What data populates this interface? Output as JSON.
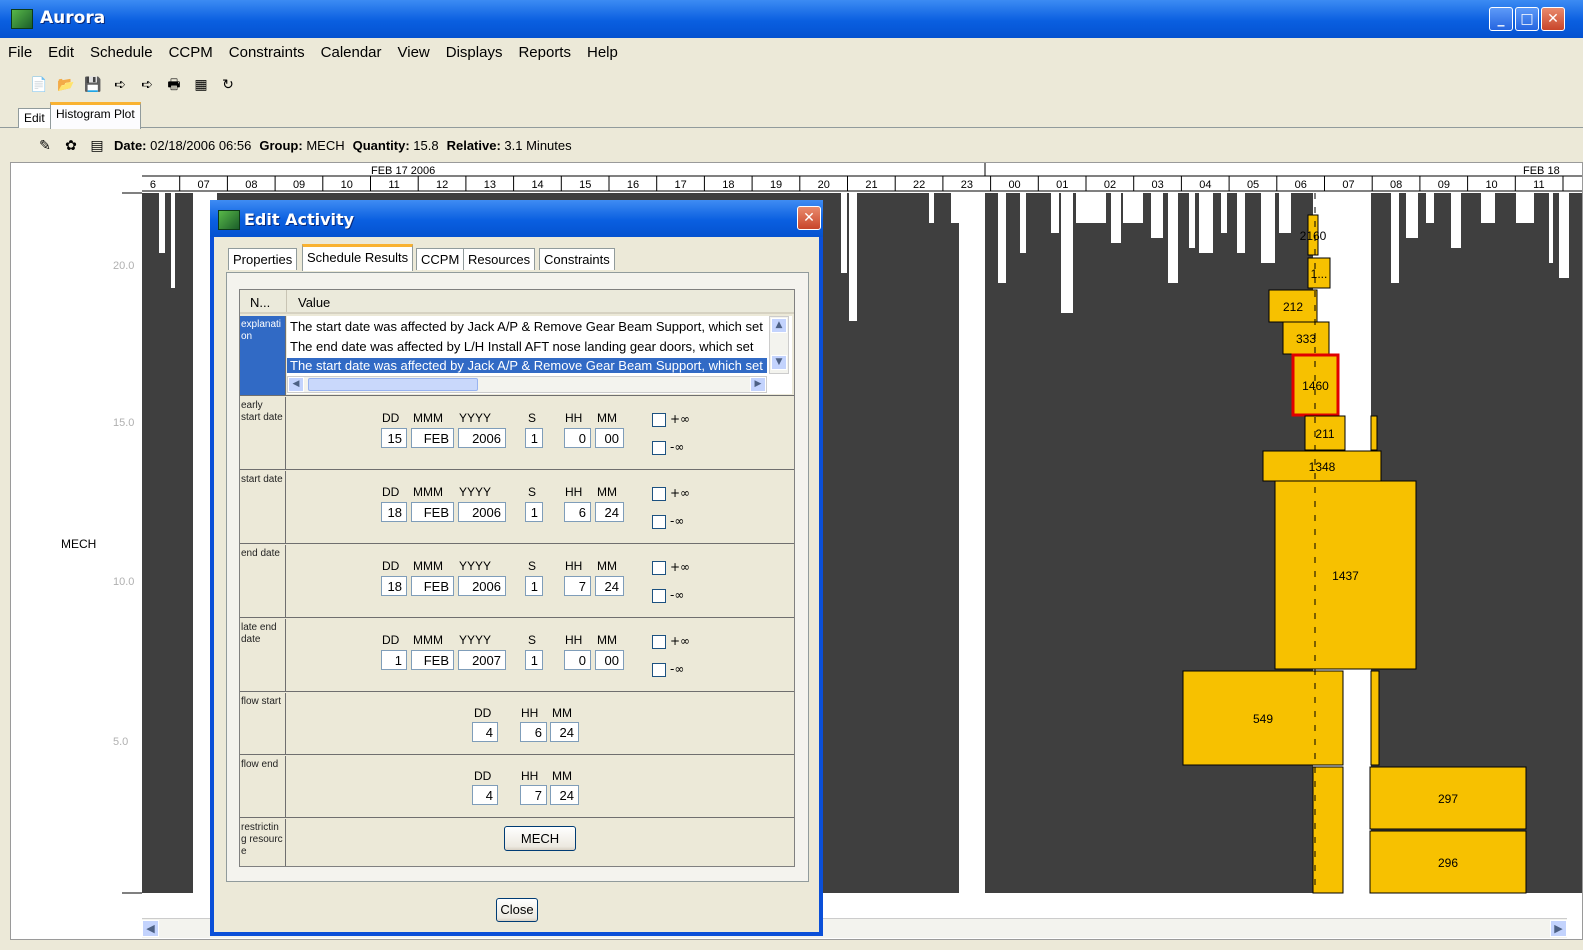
{
  "window": {
    "title": "Aurora"
  },
  "menu": [
    "File",
    "Edit",
    "Schedule",
    "CCPM",
    "Constraints",
    "Calendar",
    "View",
    "Displays",
    "Reports",
    "Help"
  ],
  "tabs": [
    "Edit",
    "Histogram Plot"
  ],
  "infobar": {
    "date_label": "Date:",
    "date_value": "02/18/2006 06:56",
    "group_label": "Group:",
    "group_value": "MECH",
    "quantity_label": "Quantity:",
    "quantity_value": "15.8",
    "relative_label": "Relative:",
    "relative_value": "3.1 Minutes"
  },
  "chart": {
    "date_label_1": "FEB 17 2006",
    "date_label_2": "FEB 18",
    "hours": [
      "6",
      "07",
      "08",
      "09",
      "10",
      "11",
      "12",
      "13",
      "14",
      "15",
      "16",
      "17",
      "18",
      "19",
      "20",
      "21",
      "22",
      "23",
      "00",
      "01",
      "02",
      "03",
      "04",
      "05",
      "06",
      "07",
      "08",
      "09",
      "10",
      "11"
    ],
    "y_ticks": [
      "20.0",
      "15.0",
      "10.0",
      "5.0"
    ],
    "group_name": "MECH",
    "bar_labels": [
      "2160",
      "1...",
      "212",
      "333",
      "1460",
      "211",
      "1348",
      "1437",
      "549",
      "297",
      "296"
    ],
    "colors": {
      "background_bars": "#3f3f3f",
      "activity": "#f7c100",
      "selected_border": "#e00000"
    }
  },
  "dialog": {
    "title": "Edit Activity",
    "tabs": [
      "Properties",
      "Schedule Results",
      "CCPM",
      "Resources",
      "Constraints"
    ],
    "table_headers": [
      "N...",
      "Value"
    ],
    "explanation": {
      "name": "explanation",
      "lines": [
        "The start date was affected by Jack A/P & Remove Gear Beam Support, which set",
        "The end date was affected by L/H Install AFT nose landing gear doors, which set",
        "The start date was affected by Jack A/P & Remove Gear Beam Support, which set"
      ]
    },
    "date_headers": {
      "dd": "DD",
      "mmm": "MMM",
      "yyyy": "YYYY",
      "s": "S",
      "hh": "HH",
      "mm": "MM"
    },
    "plus_inf": "+∞",
    "minus_inf": "-∞",
    "rows": [
      {
        "name": "early start date",
        "dd": "15",
        "mmm": "FEB",
        "yyyy": "2006",
        "s": "1",
        "hh": "0",
        "mm": "00"
      },
      {
        "name": "start date",
        "dd": "18",
        "mmm": "FEB",
        "yyyy": "2006",
        "s": "1",
        "hh": "6",
        "mm": "24"
      },
      {
        "name": "end date",
        "dd": "18",
        "mmm": "FEB",
        "yyyy": "2006",
        "s": "1",
        "hh": "7",
        "mm": "24"
      },
      {
        "name": "late end date",
        "dd": "1",
        "mmm": "FEB",
        "yyyy": "2007",
        "s": "1",
        "hh": "0",
        "mm": "00"
      }
    ],
    "flow_rows": [
      {
        "name": "flow start",
        "dd": "4",
        "hh": "6",
        "mm": "24"
      },
      {
        "name": "flow end",
        "dd": "4",
        "hh": "7",
        "mm": "24"
      }
    ],
    "restricting": {
      "name": "restricting resource",
      "button": "MECH"
    },
    "close_button": "Close"
  }
}
